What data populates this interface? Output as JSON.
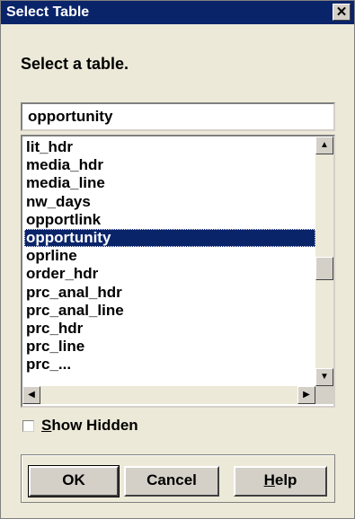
{
  "window": {
    "title": "Select Table",
    "close_glyph": "✕"
  },
  "prompt": "Select a table.",
  "filter": {
    "value": "opportunity"
  },
  "list": {
    "items": [
      "lit_hdr",
      "media_hdr",
      "media_line",
      "nw_days",
      "opportlink",
      "opportunity",
      "oprline",
      "order_hdr",
      "prc_anal_hdr",
      "prc_anal_line",
      "prc_hdr",
      "prc_line",
      "prc_..."
    ],
    "selected": "opportunity"
  },
  "show_hidden": {
    "label_prefix": "",
    "accel": "S",
    "label_rest": "how Hidden",
    "checked": false
  },
  "buttons": {
    "ok": "OK",
    "cancel": "Cancel",
    "help_accel": "H",
    "help_rest": "elp"
  },
  "colors": {
    "titlebar": "#0a246a",
    "selection": "#0a246a",
    "face": "#d4d0c8"
  },
  "icons": {
    "close": "close-icon",
    "scroll_up": "arrow-up-icon",
    "scroll_down": "arrow-down-icon",
    "scroll_left": "arrow-left-icon",
    "scroll_right": "arrow-right-icon"
  }
}
